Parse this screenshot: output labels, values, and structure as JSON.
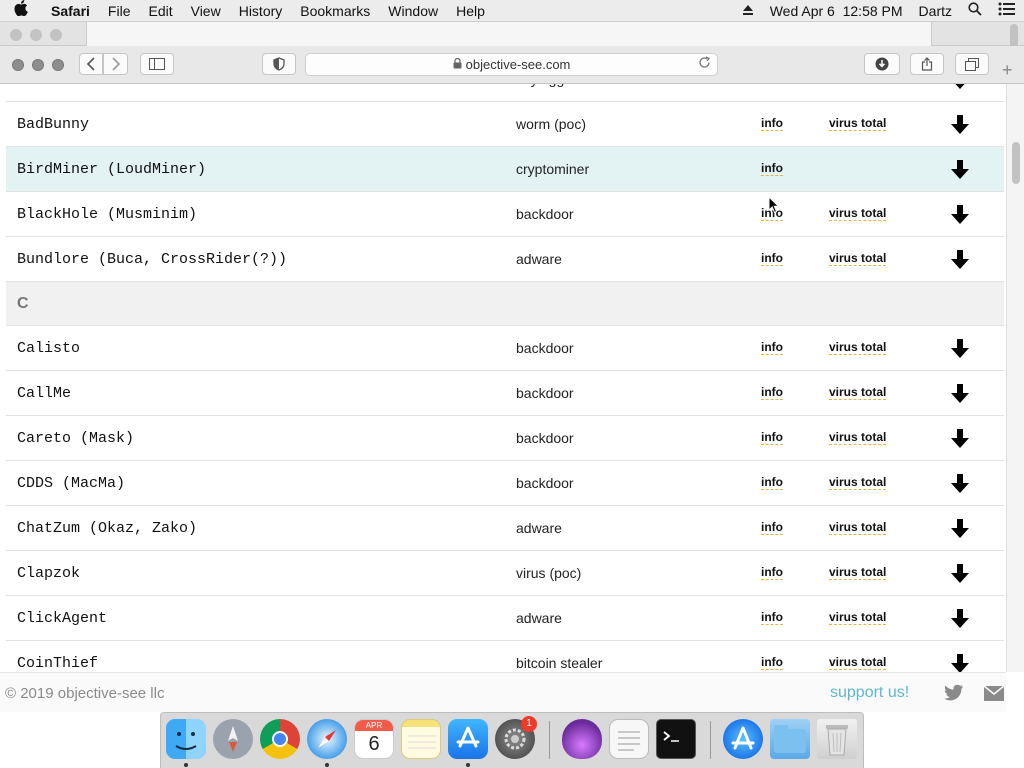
{
  "menubar": {
    "app_name": "Safari",
    "menus": [
      "File",
      "Edit",
      "View",
      "History",
      "Bookmarks",
      "Window",
      "Help"
    ],
    "clock": "Wed Apr 6  12:58 PM",
    "user": "Dartz"
  },
  "browser": {
    "url": "objective-see.com"
  },
  "table": {
    "partial_top_row": {
      "name": "",
      "type": "keylogger"
    },
    "rows_before_section": [
      {
        "name": "BadBunny",
        "type": "worm (poc)",
        "info": "info",
        "vt": "virus total"
      },
      {
        "name": "BirdMiner (LoudMiner)",
        "type": "cryptominer",
        "info": "info",
        "vt": ""
      },
      {
        "name": "BlackHole (Musminim)",
        "type": "backdoor",
        "info": "info",
        "vt": "virus total"
      },
      {
        "name": "Bundlore (Buca, CrossRider(?))",
        "type": "adware",
        "info": "info",
        "vt": "virus total"
      }
    ],
    "section_letter": "C",
    "rows_after_section": [
      {
        "name": "Calisto",
        "type": "backdoor",
        "info": "info",
        "vt": "virus total"
      },
      {
        "name": "CallMe",
        "type": "backdoor",
        "info": "info",
        "vt": "virus total"
      },
      {
        "name": "Careto (Mask)",
        "type": "backdoor",
        "info": "info",
        "vt": "virus total"
      },
      {
        "name": "CDDS (MacMa)",
        "type": "backdoor",
        "info": "info",
        "vt": "virus total"
      },
      {
        "name": "ChatZum (Okaz, Zako)",
        "type": "adware",
        "info": "info",
        "vt": "virus total"
      },
      {
        "name": "Clapzok",
        "type": "virus (poc)",
        "info": "info",
        "vt": "virus total"
      },
      {
        "name": "ClickAgent",
        "type": "adware",
        "info": "info",
        "vt": "virus total"
      },
      {
        "name": "CoinThief",
        "type": "bitcoin stealer",
        "info": "info",
        "vt": "virus total"
      }
    ]
  },
  "footer": {
    "copyright": "© 2019 objective-see llc",
    "support": "support us!"
  },
  "dock": {
    "calendar_month": "APR",
    "calendar_day": "6",
    "badge_count": "1"
  },
  "colors": {
    "highlight_row": "#e3f3f4",
    "support_link": "#5fb7cf",
    "section_bg": "#f1f1f1"
  }
}
